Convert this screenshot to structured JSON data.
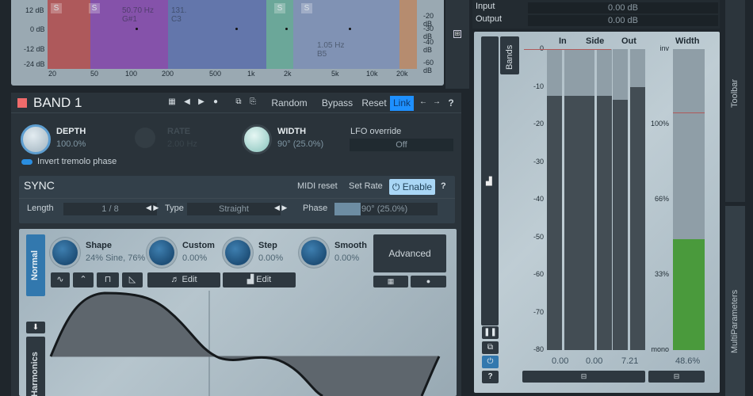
{
  "spectrum": {
    "y_labels_left": [
      "12 dB",
      "0 dB",
      "-12 dB",
      "-24 dB"
    ],
    "y_labels_right": [
      "-20 dB",
      "-30 dB",
      "-40 dB",
      "-60 dB"
    ],
    "x_labels": [
      "20",
      "50",
      "100",
      "200",
      "500",
      "1k",
      "2k",
      "5k",
      "10k",
      "20k"
    ],
    "band_freq_labels": [
      {
        "hz": "50.70 Hz",
        "note": "G#1"
      },
      {
        "hz": "131.",
        "note": "C3"
      },
      {
        "hz": "1.05 Hz",
        "note": "B5"
      }
    ],
    "solo_label": "S",
    "colors": {
      "band1": "#b03a3a",
      "band2": "#7a3aa0",
      "band3": "#3f55a0",
      "band4": "#3a9a7a",
      "band5": "#6a9a4a",
      "band6": "#c0703a"
    }
  },
  "band": {
    "title": "BAND 1",
    "color": "#f06b6b",
    "toolbar": {
      "random": "Random",
      "bypass": "Bypass",
      "reset": "Reset",
      "link": "Link",
      "help": "?"
    },
    "depth": {
      "label": "DEPTH",
      "value": "100.0%"
    },
    "rate": {
      "label": "RATE",
      "value": "2.00 Hz"
    },
    "width": {
      "label": "WIDTH",
      "value": "90° (25.0%)"
    },
    "lfo_override": {
      "label": "LFO override",
      "value": "Off"
    },
    "invert_label": "Invert tremolo phase"
  },
  "sync": {
    "title": "SYNC",
    "midi_reset": "MIDI reset",
    "set_rate": "Set Rate",
    "enable": "Enable",
    "help": "?",
    "length_label": "Length",
    "length_value": "1 / 8",
    "type_label": "Type",
    "type_value": "Straight",
    "phase_label": "Phase",
    "phase_value": "90° (25.0%)",
    "phase_fraction": 0.25
  },
  "lfo": {
    "mode_tabs": [
      "Normal",
      "Harmonics"
    ],
    "shape": {
      "label": "Shape",
      "value": "24% Sine, 76%"
    },
    "custom": {
      "label": "Custom",
      "value": "0.00%"
    },
    "step": {
      "label": "Step",
      "value": "0.00%"
    },
    "smooth": {
      "label": "Smooth",
      "value": "0.00%"
    },
    "advanced": "Advanced",
    "edit1": "Edit",
    "edit2": "Edit"
  },
  "io": {
    "input_label": "Input",
    "input_value": "0.00 dB",
    "output_label": "Output",
    "output_value": "0.00 dB"
  },
  "meters": {
    "bands_label": "Bands",
    "headers": [
      "In",
      "Side",
      "Out",
      "Width"
    ],
    "db_ticks": [
      "0",
      "-10",
      "-20",
      "-30",
      "-40",
      "-50",
      "-60",
      "-70",
      "-80"
    ],
    "width_ticks": [
      "inv",
      "100%",
      "66%",
      "33%",
      "mono"
    ],
    "levels_db": [
      -12.5,
      -12.5,
      -12.5,
      -12.5,
      -13.5,
      -10.0
    ],
    "values": [
      "0.00",
      "0.00",
      "7.21"
    ],
    "width_value": "48.6%",
    "width_fraction": 0.486,
    "width_color": "#4a9a3c"
  },
  "side_tabs": {
    "toolbar": "Toolbar",
    "multiparameters": "MultiParameters"
  }
}
